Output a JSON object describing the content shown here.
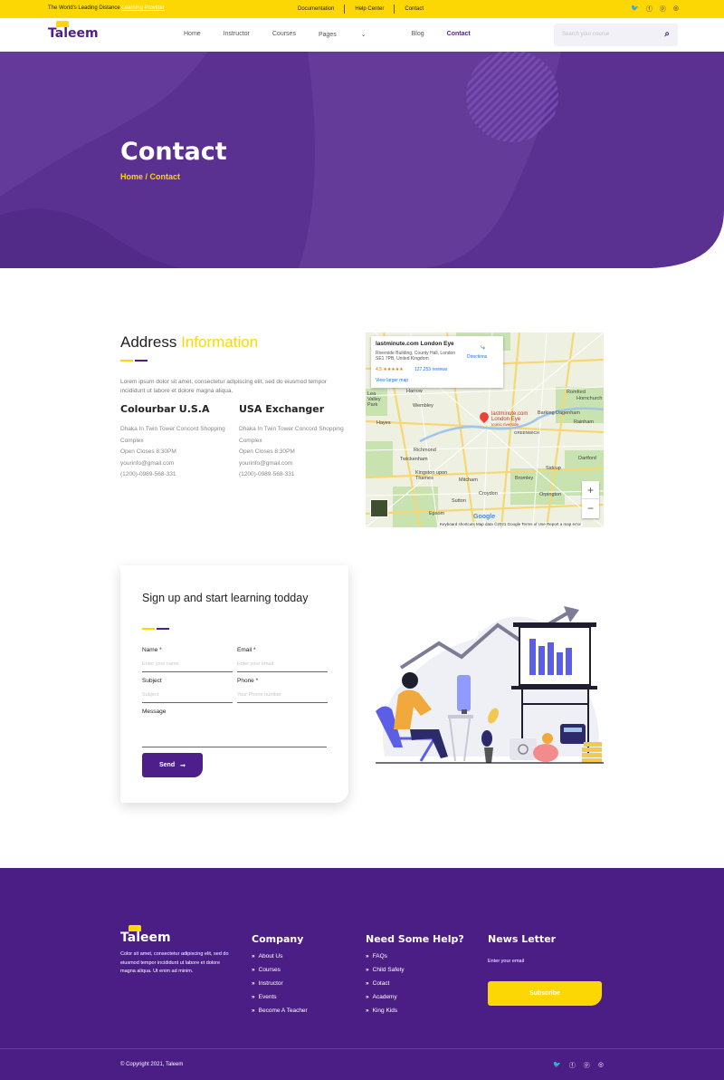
{
  "topbar": {
    "tagline_prefix": "The World's Leading Distance",
    "tagline_highlight": "Learning Provider",
    "links": [
      "Documentation",
      "Help Center",
      "Contact"
    ],
    "social_icons": [
      "twitter-icon",
      "facebook-icon",
      "pinterest-icon",
      "instagram-icon"
    ]
  },
  "header": {
    "logo": "Taleem",
    "nav": [
      "Home",
      "Instructor",
      "Courses",
      "Pages",
      "Blog",
      "Contact"
    ],
    "active_nav": "Contact",
    "search_placeholder": "Search your course"
  },
  "hero": {
    "title": "Contact",
    "breadcrumb": "Home / Contact"
  },
  "address": {
    "title_a": "Address",
    "title_b": "Information",
    "desc": "Lorem ipsum dolor sit amet, consectetur adipiscing elit, sed do eiusmod tempor incididunt ut labore et dolore magna aliqua.",
    "offices": [
      {
        "name": "Colourbar U.S.A",
        "address": "Dhaka In Twin Tower Concord Shopping Complex",
        "hours": "Open Closes 8:30PM",
        "email": "yourinfo@gmail.com",
        "phone": "(1200)-0989-568-331"
      },
      {
        "name": "USA Exchanger",
        "address": "Dhaka In Twin Tower Concord Shopping Complex",
        "hours": "Open Closes 8:30PM",
        "email": "yourinfo@gmail.com",
        "phone": "(1200)-0989-568-331"
      }
    ]
  },
  "map": {
    "place": "lastminute.com London Eye",
    "place_address": "Riverside Building, County Hall, London SE1 7PB, United Kingdom",
    "rating": "4.5 ★★★★★",
    "reviews": "127,253 reviews",
    "larger_map": "View larger map",
    "directions": "Directions",
    "pin_label": "lastminute.com London Eye",
    "pin_sub": "Iconic riverside",
    "areas": [
      "Harrow",
      "Wembley",
      "Hayes",
      "Richmond",
      "Twickenham",
      "Kingston upon Thames",
      "Mitcham",
      "Croydon",
      "Sutton",
      "Epsom",
      "Bromley",
      "Romford",
      "Dartford",
      "Orpington",
      "Sidcup",
      "Barking",
      "Dagenham",
      "Rainham",
      "Hornchurch",
      "GREENWICH",
      "Lea Valley Park"
    ],
    "footer": "Keyboard shortcuts   Map data ©2021 Google   Terms of Use   Report a map error",
    "google": "Google",
    "zoom_in": "+",
    "zoom_out": "−"
  },
  "form": {
    "title": "Sign up and start learning todday",
    "name_label": "Name *",
    "name_placeholder": "Enter your name",
    "email_label": "Email *",
    "email_placeholder": "Enter your email",
    "subject_label": "Subject",
    "subject_placeholder": "Subject",
    "phone_label": "Phone *",
    "phone_placeholder": "Your Phone number",
    "message_label": "Message",
    "send_label": "Send",
    "send_icon": "arrow-right-icon"
  },
  "footer": {
    "logo": "Taleem",
    "desc": "Color sit amet, consectetur adipiscing elit, sed do eiusmod tempor incididunt ut labore et dolore magna aliqua. Ut enim ad minim.",
    "company_title": "Company",
    "company_links": [
      "About Us",
      "Courses",
      "Instructor",
      "Events",
      "Become A Teacher"
    ],
    "help_title": "Need Some Help?",
    "help_links": [
      "FAQs",
      "Child Safety",
      "Cotact",
      "Academy",
      "King Kids"
    ],
    "newsletter_title": "News Letter",
    "newsletter_placeholder": "Enter your email",
    "subscribe_label": "Subscribe",
    "copyright": "© Copyright 2021, Taleem",
    "social_icons": [
      "twitter-icon",
      "facebook-icon",
      "pinterest-icon",
      "instagram-icon"
    ]
  },
  "colors": {
    "brand_purple": "#4e1f8a",
    "accent_yellow": "#fcd703"
  }
}
